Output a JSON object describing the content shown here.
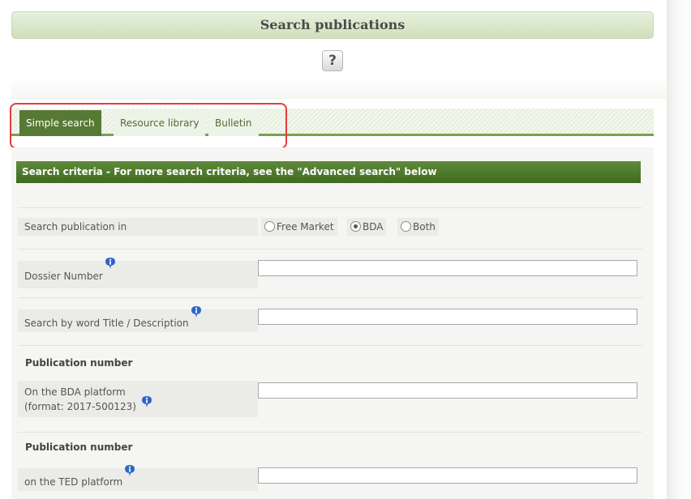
{
  "page": {
    "title": "Search publications",
    "help_symbol": "?"
  },
  "tabs": [
    {
      "label": "Simple search",
      "active": true
    },
    {
      "label": "Resource library",
      "active": false
    },
    {
      "label": "Bulletin",
      "active": false
    }
  ],
  "criteria": {
    "header": "Search criteria - For more search criteria, see the \"Advanced search\" below"
  },
  "search_in": {
    "label": "Search publication in",
    "options": [
      {
        "label": "Free Market",
        "checked": false
      },
      {
        "label": "BDA",
        "checked": true
      },
      {
        "label": "Both",
        "checked": false
      }
    ]
  },
  "fields": {
    "dossier": {
      "label": "Dossier Number",
      "value": ""
    },
    "title_desc": {
      "label": "Search by word Title / Description",
      "value": ""
    },
    "bda_pub": {
      "section": "Publication number",
      "line1": "On the BDA platform",
      "line2": "(format: 2017-500123)",
      "value": ""
    },
    "ted_pub": {
      "section": "Publication number",
      "label": "on the TED platform",
      "value": ""
    }
  },
  "colors": {
    "tab_active": "#567a34",
    "header_green": "#4f7a2e",
    "highlight": "#e53b3b"
  }
}
